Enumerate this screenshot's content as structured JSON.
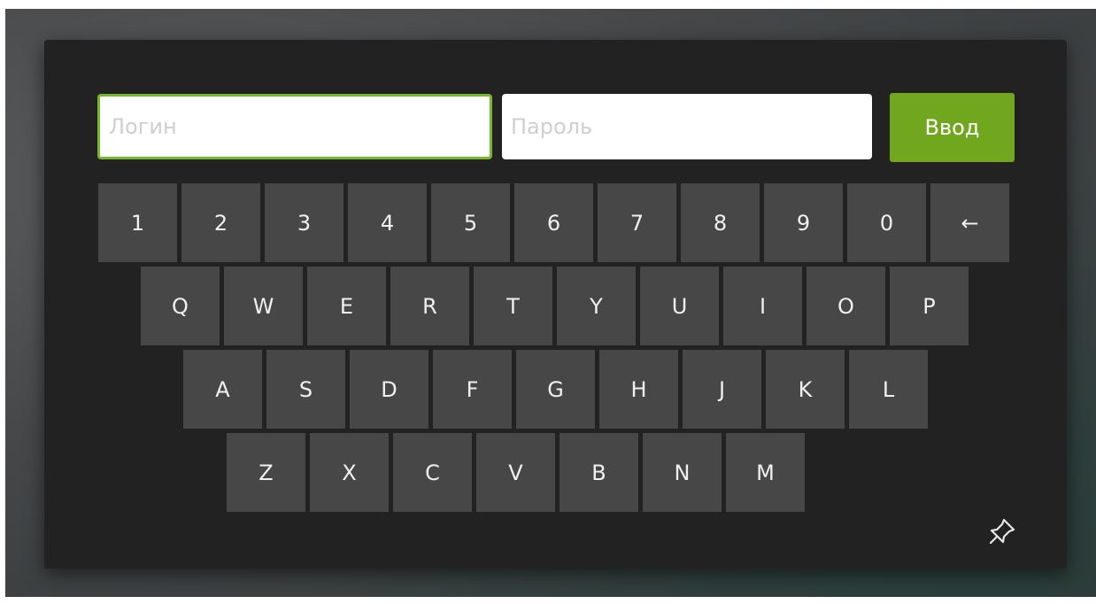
{
  "form": {
    "login_placeholder": "Логин",
    "password_placeholder": "Пароль",
    "enter_label": "Ввод"
  },
  "keyboard": {
    "row1": [
      "1",
      "2",
      "3",
      "4",
      "5",
      "6",
      "7",
      "8",
      "9",
      "0",
      "←"
    ],
    "row2": [
      "Q",
      "W",
      "E",
      "R",
      "T",
      "Y",
      "U",
      "I",
      "O",
      "P"
    ],
    "row3": [
      "A",
      "S",
      "D",
      "F",
      "G",
      "H",
      "J",
      "K",
      "L"
    ],
    "row4": [
      "Z",
      "X",
      "C",
      "V",
      "B",
      "N",
      "M"
    ]
  },
  "icons": {
    "pin": "pin-icon"
  },
  "colors": {
    "accent": "#71a61f",
    "panel": "#222222",
    "key": "#474747"
  }
}
